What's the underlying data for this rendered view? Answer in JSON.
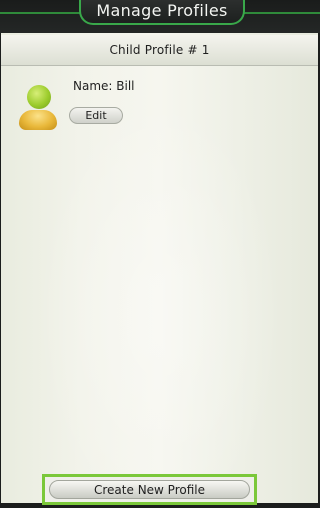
{
  "header": {
    "title": "Manage Profiles"
  },
  "section": {
    "title": "Child Profile # 1"
  },
  "profile": {
    "name_line": "Name: Bill",
    "edit_label": "Edit",
    "avatar_icon": "person-icon"
  },
  "footer": {
    "create_label": "Create New Profile"
  },
  "colors": {
    "accent_green": "#39a84a",
    "highlight_green": "#7bc83a",
    "panel_bg": "#f2f3ea",
    "header_bg": "#1b1d1c"
  }
}
